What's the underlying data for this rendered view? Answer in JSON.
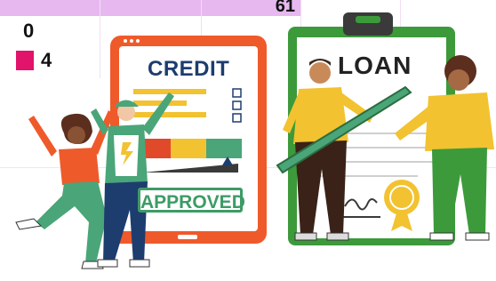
{
  "chart_overlay": {
    "top_value": "61",
    "row_values": [
      "0",
      "4"
    ],
    "swatch_color": "#e1136a",
    "bar_color": "#e6b8ef"
  },
  "illustration": {
    "credit_card_title": "CREDIT",
    "approved_stamp": "APPROVED",
    "loan_doc_title": "LOAN",
    "colors": {
      "tablet_orange": "#ef5a2b",
      "clipboard_green": "#3c9a3a",
      "navy": "#1d3d6e",
      "yellow": "#f2c230",
      "green_meter": "#4aa579",
      "red_meter": "#e1492b"
    }
  }
}
